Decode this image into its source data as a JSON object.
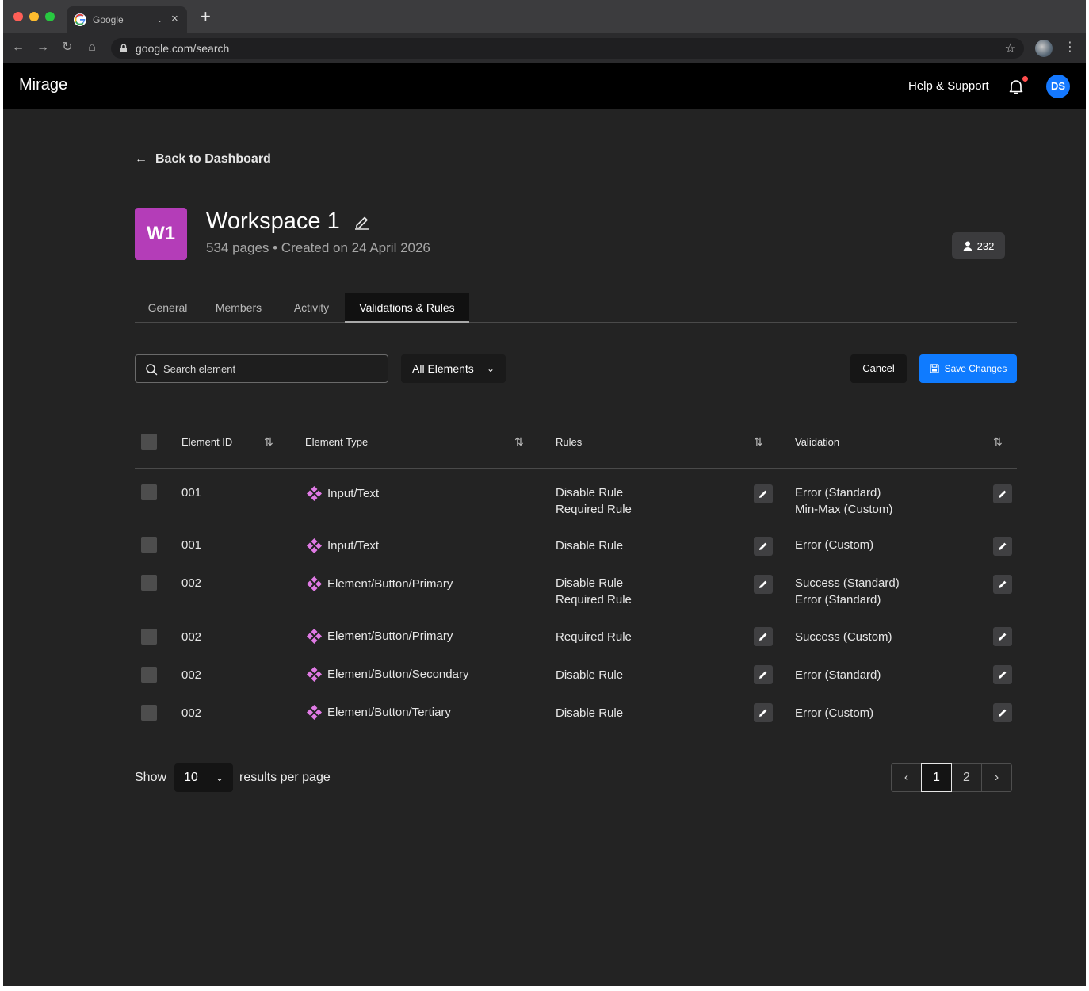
{
  "browser": {
    "tab_title": "Google",
    "tab_close": "×",
    "tab_dot": ".",
    "new_tab": "+",
    "url": "google.com/search"
  },
  "app": {
    "brand": "Mirage",
    "help": "Help & Support",
    "avatar_initials": "DS"
  },
  "page": {
    "back_label": "Back to Dashboard",
    "workspace_initials": "W1",
    "workspace_title": "Workspace 1",
    "workspace_meta": "534 pages • Created on 24 April 2026",
    "member_count": "232"
  },
  "tabs": [
    {
      "label": "General"
    },
    {
      "label": "Members"
    },
    {
      "label": "Activity"
    },
    {
      "label": "Validations & Rules"
    }
  ],
  "active_tab": "Validations & Rules",
  "toolbar": {
    "search_placeholder": "Search element",
    "filter_label": "All Elements",
    "cancel_label": "Cancel",
    "save_label": "Save Changes"
  },
  "table": {
    "headers": [
      "Element ID",
      "Element Type",
      "Rules",
      "Validation"
    ],
    "rows": [
      {
        "id": "001",
        "type": "Input/Text",
        "rules": [
          "Disable Rule",
          "Required Rule"
        ],
        "validation": [
          "Error (Standard)",
          "Min-Max (Custom)"
        ]
      },
      {
        "id": "001",
        "type": "Input/Text",
        "rules": [
          "Disable Rule"
        ],
        "validation": [
          "Error (Custom)"
        ]
      },
      {
        "id": "002",
        "type": "Element/Button/Primary",
        "rules": [
          "Disable Rule",
          "Required Rule"
        ],
        "validation": [
          "Success (Standard)",
          "Error (Standard)"
        ]
      },
      {
        "id": "002",
        "type": "Element/Button/Primary",
        "rules": [
          "Required Rule"
        ],
        "validation": [
          "Success (Custom)"
        ]
      },
      {
        "id": "002",
        "type": "Element/Button/Secondary",
        "rules": [
          "Disable Rule"
        ],
        "validation": [
          "Error (Standard)"
        ]
      },
      {
        "id": "002",
        "type": "Element/Button/Tertiary",
        "rules": [
          "Disable Rule"
        ],
        "validation": [
          "Error (Custom)"
        ]
      }
    ]
  },
  "pagination": {
    "show_label": "Show",
    "per_page": "10",
    "results_label": "results per page",
    "pages": [
      "1",
      "2"
    ],
    "current_page": "1"
  },
  "colors": {
    "accent": "#0f7bff",
    "workspace_logo": "#b43db8",
    "component_icon": "#e07ae4",
    "notification_dot": "#ff4d4d"
  }
}
